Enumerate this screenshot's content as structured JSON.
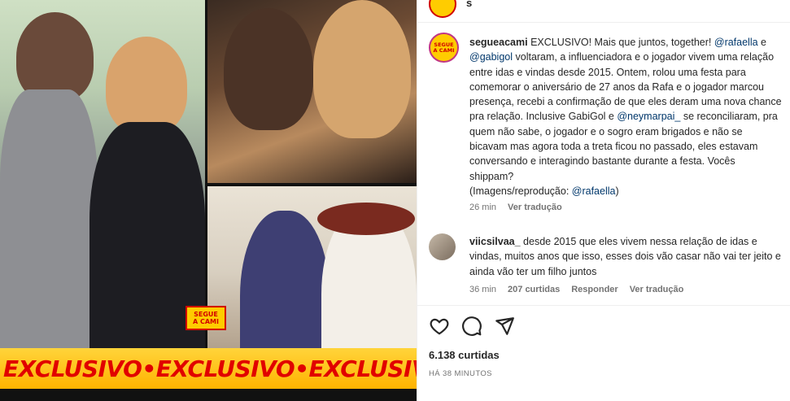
{
  "post": {
    "header_username": "s",
    "username": "segueacami",
    "caption_parts": [
      {
        "t": "text",
        "v": "EXCLUSIVO! Mais que juntos, together! "
      },
      {
        "t": "mention",
        "v": "@rafaella"
      },
      {
        "t": "text",
        "v": " e "
      },
      {
        "t": "mention",
        "v": "@gabigol"
      },
      {
        "t": "text",
        "v": " voltaram, a influenciadora e o jogador vivem uma relação entre idas e vindas desde 2015. Ontem, rolou uma festa para comemorar o aniversário de 27 anos da Rafa e o jogador marcou presença, recebi a confirmação de que eles deram uma nova chance pra relação. Inclusive GabiGol e "
      },
      {
        "t": "mention",
        "v": "@neymarpai_"
      },
      {
        "t": "text",
        "v": " se reconciliaram, pra quem não sabe, o jogador e o sogro eram brigados e não se bicavam mas agora toda a treta ficou no passado, eles estavam conversando e interagindo bastante durante a festa. Vocês shippam?"
      },
      {
        "t": "br"
      },
      {
        "t": "text",
        "v": "(Imagens/reprodução: "
      },
      {
        "t": "mention",
        "v": "@rafaella"
      },
      {
        "t": "text",
        "v": ")"
      }
    ],
    "caption_time": "26 min",
    "caption_translate": "Ver tradução",
    "likes": "6.138 curtidas",
    "posted_ago": "HÁ 38 MINUTOS"
  },
  "logo": {
    "line1": "SEGUE",
    "line2": "A CAMI"
  },
  "banner_text": "EXCLUSIVO•EXCLUSIVO•EXCLUSIVO•EXCLUSIVO",
  "comment": {
    "username": "viicsilvaa_",
    "text": " desde 2015 que eles vivem nessa relação de idas e vindas, muitos anos que isso, esses dois vão casar não vai ter jeito e ainda vão ter um filho juntos",
    "time": "36 min",
    "likes": "207 curtidas",
    "reply": "Responder",
    "translate": "Ver tradução"
  },
  "icons": [
    "heart-icon",
    "comment-icon",
    "share-icon"
  ],
  "colors": {
    "mention": "#00376b",
    "banner_red": "#e10000",
    "banner_yellow": "#ffc000"
  }
}
